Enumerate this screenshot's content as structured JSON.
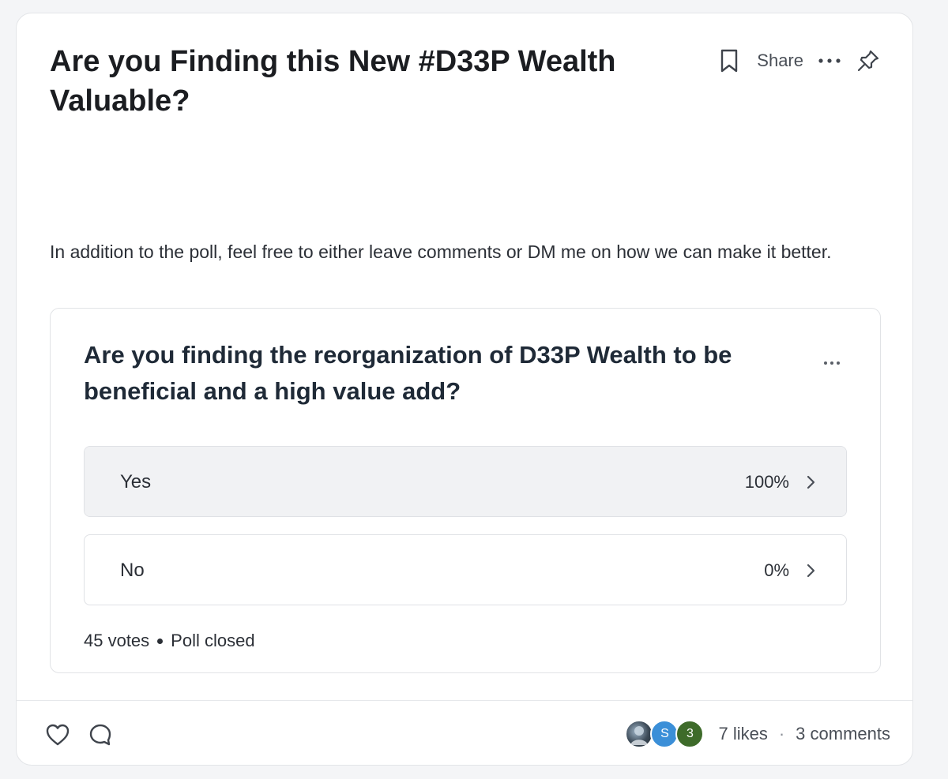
{
  "post": {
    "title": "Are you Finding this New #D33P Wealth Valuable?",
    "body": "In addition to the poll, feel free to either leave comments or DM me on how we can make it better."
  },
  "actions": {
    "share_label": "Share"
  },
  "poll": {
    "question": "Are you finding the reorganization of D33P Wealth to be beneficial and a high value add?",
    "options": [
      {
        "label": "Yes",
        "percent_text": "100%",
        "percent": 100
      },
      {
        "label": "No",
        "percent_text": "0%",
        "percent": 0
      }
    ],
    "votes_text": "45 votes",
    "status_text": "Poll closed"
  },
  "footer": {
    "avatars": [
      {
        "type": "photo",
        "initial": "",
        "color": "#3c4a57"
      },
      {
        "type": "initial",
        "initial": "S",
        "color": "#3b8fd8"
      },
      {
        "type": "initial",
        "initial": "3",
        "color": "#3e6b2a"
      }
    ],
    "likes_text": "7 likes",
    "separator": "·",
    "comments_text": "3 comments"
  },
  "icons": {
    "bookmark": "bookmark-icon",
    "more": "more-horizontal-icon",
    "pin": "pin-icon",
    "heart": "heart-icon",
    "comment": "comment-icon",
    "chevron": "chevron-right-icon"
  }
}
